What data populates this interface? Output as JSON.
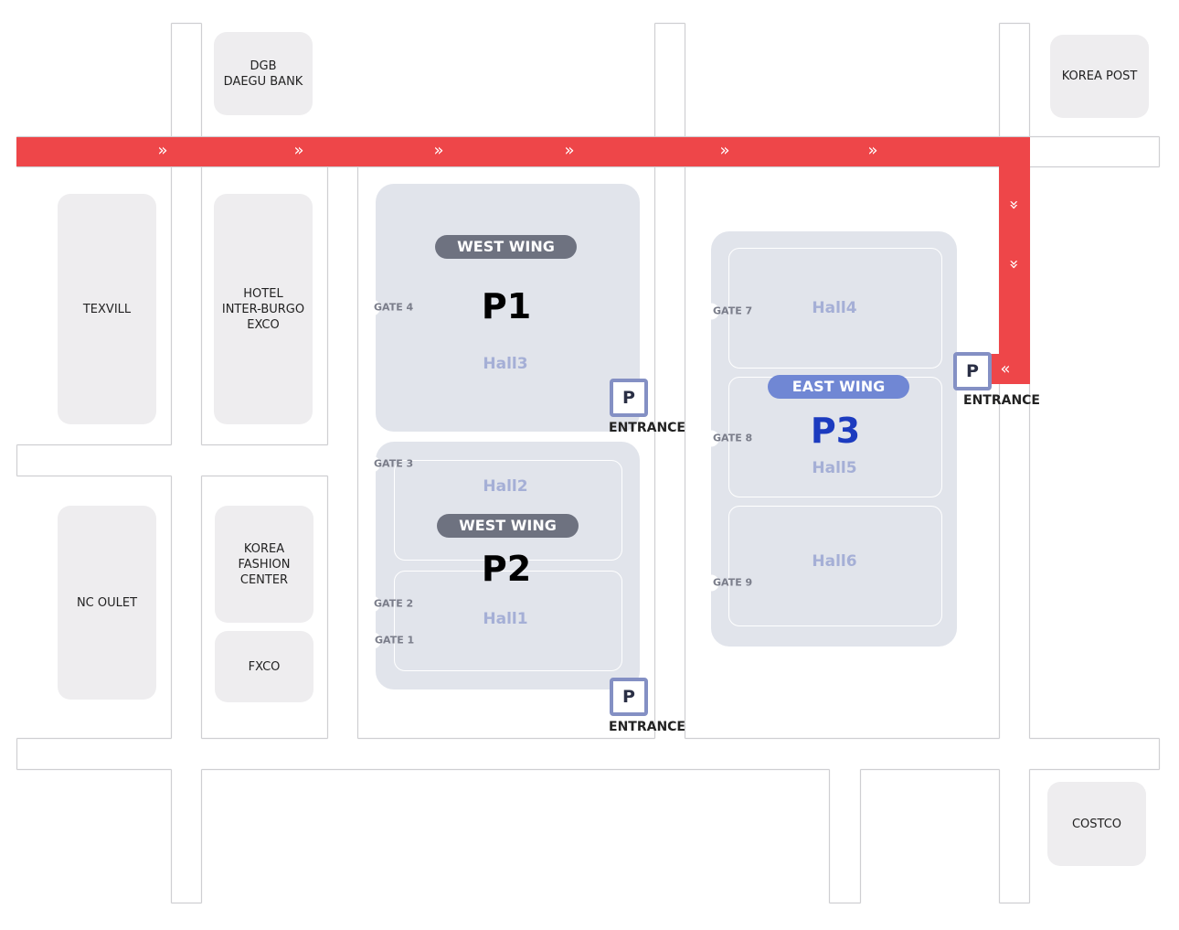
{
  "colors": {
    "route": "#ee4649",
    "hall_block": "#e1e4eb",
    "building": "#eeedef",
    "west_wing_badge": "#6e7280",
    "east_wing_badge": "#7087d4",
    "p3_text": "#1c3bbf",
    "hall_label": "#a5afd6",
    "parking_border": "#8490c4"
  },
  "buildings": [
    {
      "name": "DGB\nDAEGU BANK"
    },
    {
      "name": "KOREA POST"
    },
    {
      "name": "TEXVILL"
    },
    {
      "name": "HOTEL\nINTER-BURGO\nEXCO"
    },
    {
      "name": "NC OULET"
    },
    {
      "name": "KOREA\nFASHION\nCENTER"
    },
    {
      "name": "FXCO"
    },
    {
      "name": "COSTCO"
    }
  ],
  "halls": {
    "p1": {
      "badge": "WEST WING",
      "label": "P1",
      "hall": "Hall3"
    },
    "p2": {
      "badge": "WEST WING",
      "label": "P2",
      "halls": [
        "Hall2",
        "Hall1"
      ]
    },
    "p3": {
      "badge": "EAST WING",
      "label": "P3",
      "halls": [
        "Hall4",
        "Hall5",
        "Hall6"
      ]
    }
  },
  "gates": [
    "GATE 4",
    "GATE 3",
    "GATE 2",
    "GATE 1",
    "GATE 7",
    "GATE 8",
    "GATE 9"
  ],
  "parking": {
    "icon": "P",
    "label": "ENTRANCE"
  },
  "route_icons": {
    "right": "»",
    "down": "chevron-double-down",
    "left": "«"
  }
}
